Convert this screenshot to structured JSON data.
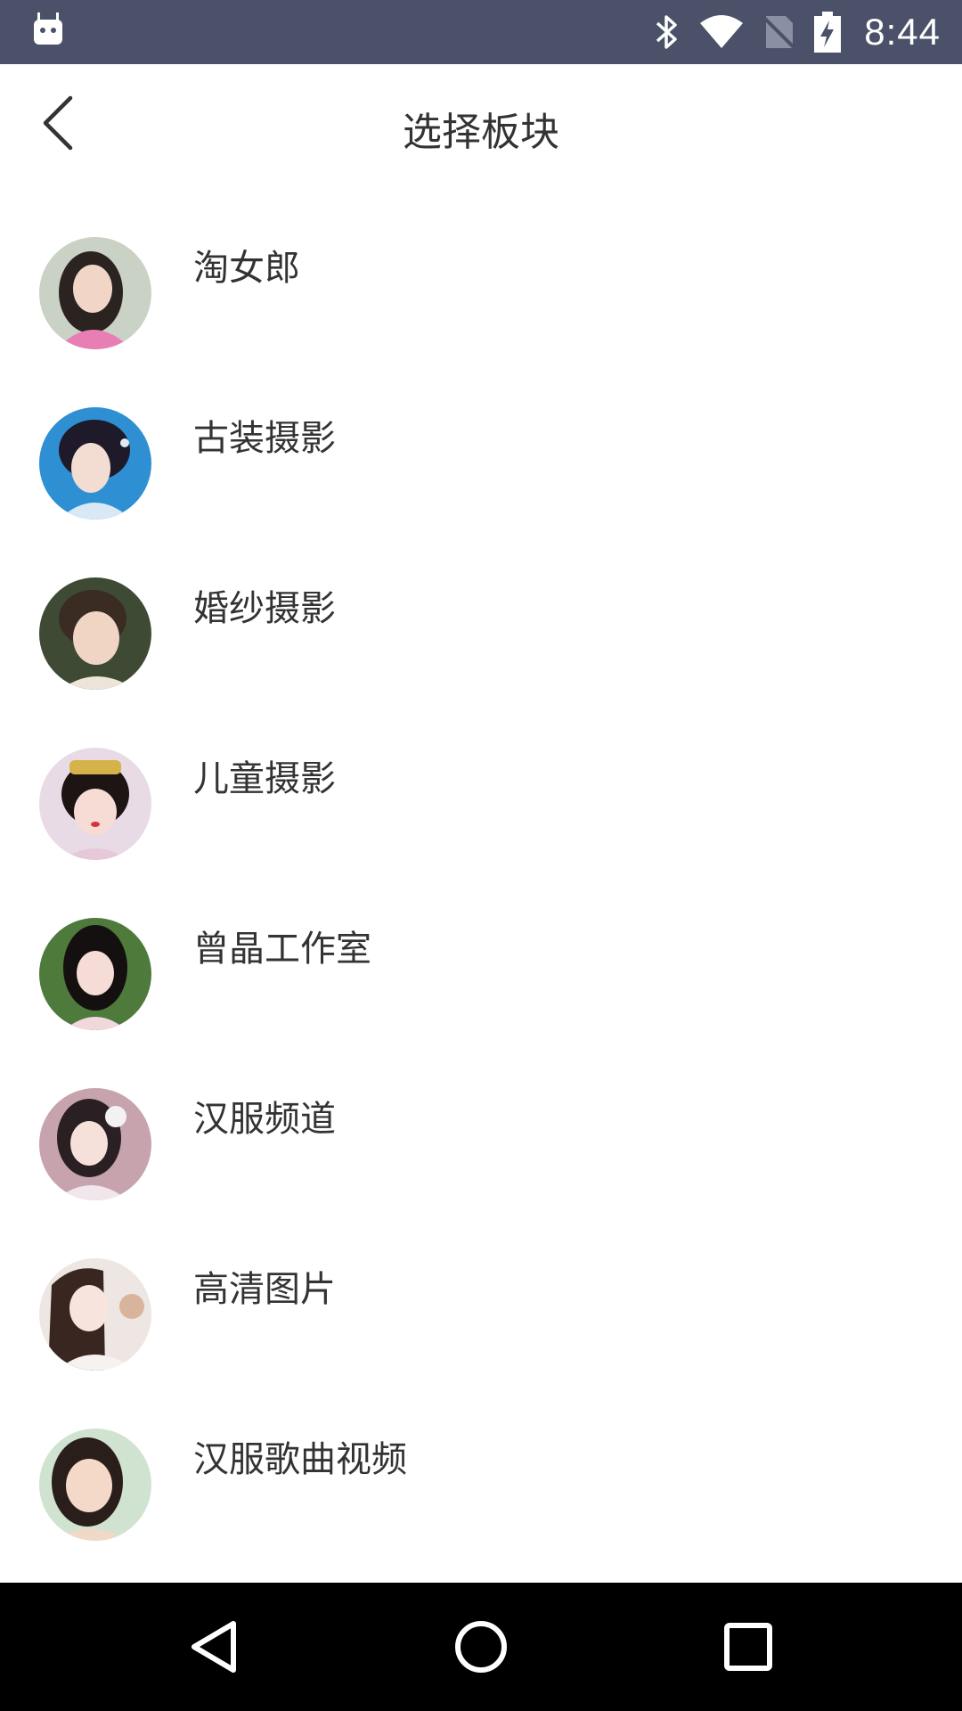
{
  "status_bar": {
    "time": "8:44",
    "icons": [
      "android-icon",
      "bluetooth-icon",
      "wifi-icon",
      "no-sim-icon",
      "battery-charging-icon"
    ]
  },
  "header": {
    "title": "选择板块",
    "back_icon": "chevron-left-icon"
  },
  "categories": [
    {
      "label": "淘女郎",
      "avatar_bg": "#c9d2c4",
      "hair": "#2b2320",
      "dress": "#e77fb4"
    },
    {
      "label": "古装摄影",
      "avatar_bg": "#2f8fd3",
      "hair": "#1e1a2a",
      "dress": "#d9e8f5"
    },
    {
      "label": "婚纱摄影",
      "avatar_bg": "#3f4a35",
      "hair": "#3a2c22",
      "dress": "#efe4da"
    },
    {
      "label": "儿童摄影",
      "avatar_bg": "#e8dbe6",
      "hair": "#1c1514",
      "dress": "#e6c8d8"
    },
    {
      "label": "曾晶工作室",
      "avatar_bg": "#4e7a3c",
      "hair": "#141010",
      "dress": "#f0d8dc"
    },
    {
      "label": "汉服频道",
      "avatar_bg": "#c7a3ad",
      "hair": "#2a2024",
      "dress": "#f1e6ec"
    },
    {
      "label": "高清图片",
      "avatar_bg": "#eee6e2",
      "hair": "#3a2620",
      "dress": "#f6f2f0"
    },
    {
      "label": "汉服歌曲视频",
      "avatar_bg": "#cfe3d0",
      "hair": "#2a1e1a",
      "dress": "#f1d9c8"
    }
  ],
  "nav_bar": {
    "buttons": [
      "back-triangle-icon",
      "home-circle-icon",
      "recents-square-icon"
    ]
  }
}
